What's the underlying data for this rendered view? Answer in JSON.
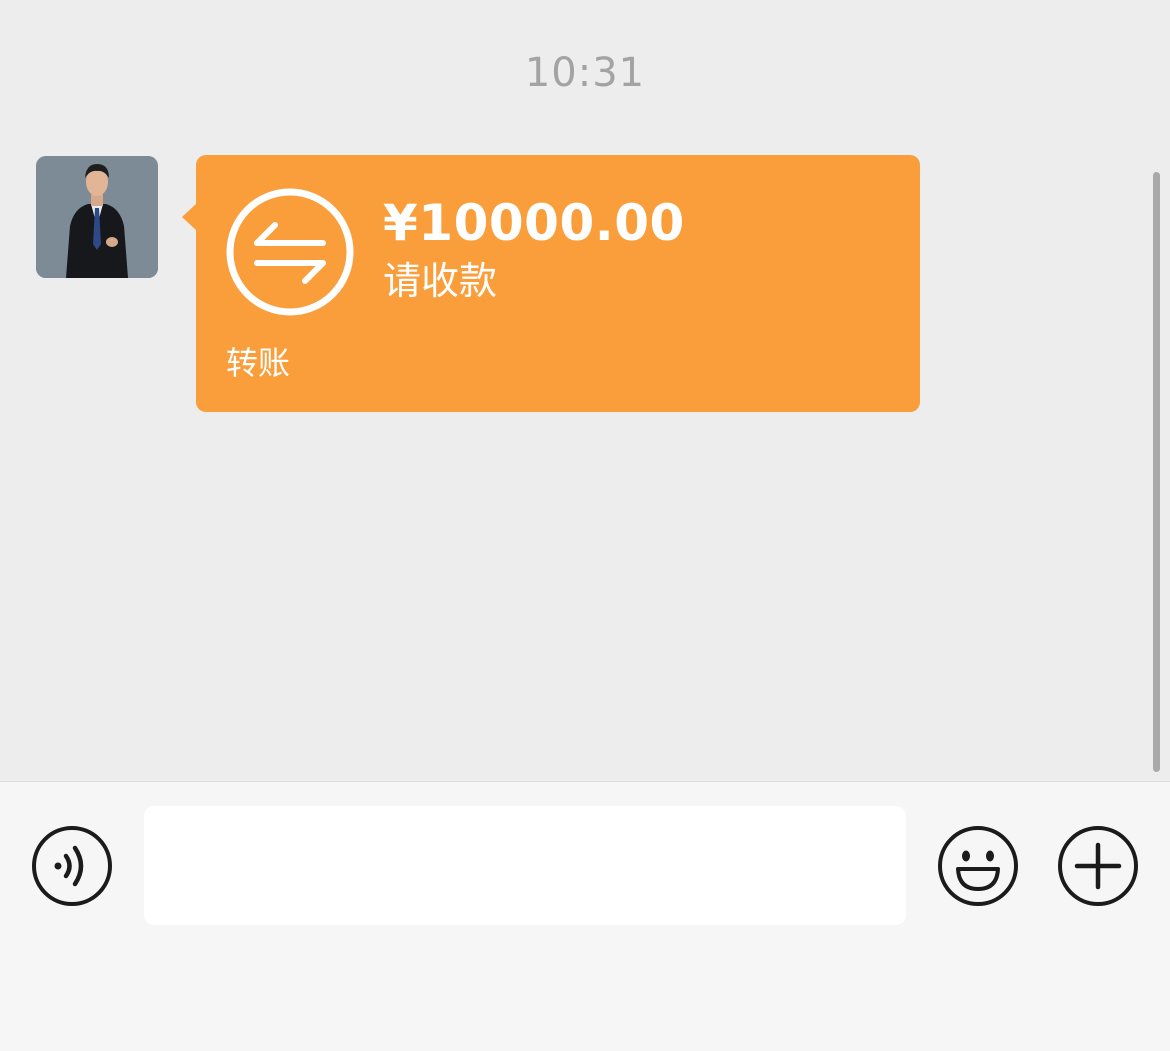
{
  "chat": {
    "timestamp": "10:31",
    "messages": [
      {
        "type": "transfer",
        "amount": "¥10000.00",
        "status_label": "请收款",
        "footer_label": "转账",
        "bubble_color": "#fa9e3b"
      }
    ]
  },
  "input_bar": {
    "text_value": "",
    "voice_icon": "voice-icon",
    "emoji_icon": "emoji-icon",
    "plus_icon": "plus-icon"
  },
  "colors": {
    "chat_background": "#ededed",
    "input_bar_background": "#f6f6f6",
    "timestamp_text": "#a3a3a3",
    "transfer_orange": "#fa9e3b"
  }
}
